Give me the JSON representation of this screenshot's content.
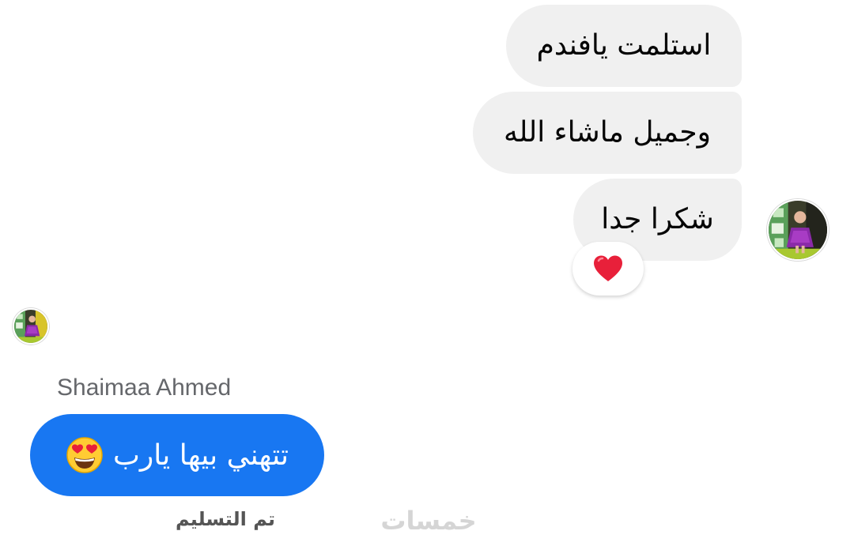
{
  "messages": [
    {
      "text": "استلمت يافندم"
    },
    {
      "text": "وجميل ماشاء الله"
    },
    {
      "text": "شكرا جدا"
    }
  ],
  "reaction": {
    "icon": "heart-icon",
    "color": "#e8203a"
  },
  "reply": {
    "sender": "Shaimaa Ahmed",
    "text": "تتهني بيها يارب",
    "emoji": "heart-eyes-emoji",
    "bubble_color": "#1877f2"
  },
  "status": "تم التسليم",
  "watermark": "خمسات"
}
